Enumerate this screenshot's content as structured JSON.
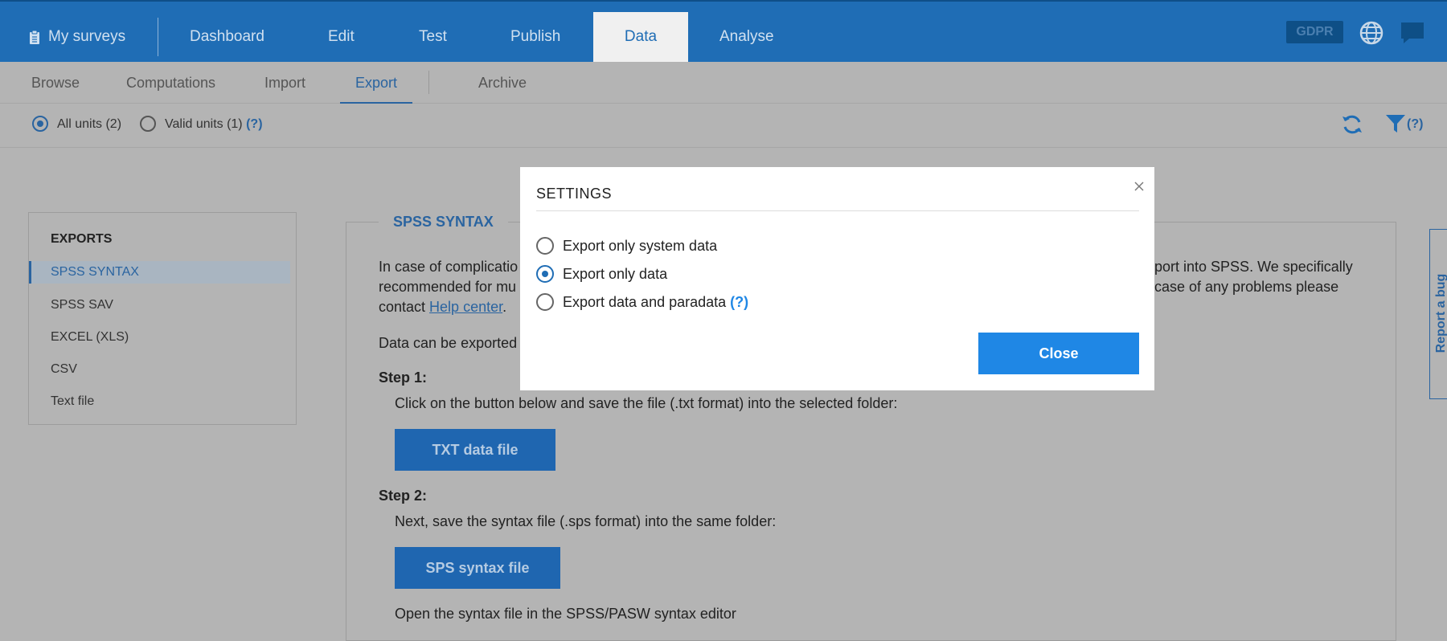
{
  "topnav": {
    "my_surveys": "My surveys",
    "items": [
      "Dashboard",
      "Edit",
      "Test",
      "Publish",
      "Data",
      "Analyse"
    ],
    "active": "Data",
    "gdpr": "GDPR"
  },
  "subnav": {
    "items": [
      "Browse",
      "Computations",
      "Import",
      "Export",
      "Archive"
    ],
    "active": "Export"
  },
  "filters": {
    "all_units": "All units (2)",
    "valid_units": "Valid units (1)",
    "help": "(?)",
    "selected": "All units (2)",
    "filter_help": "(?)"
  },
  "exports_panel": {
    "title": "EXPORTS",
    "items": [
      "SPSS SYNTAX",
      "SPSS SAV",
      "EXCEL (XLS)",
      "CSV",
      "Text file"
    ],
    "active": "SPSS SYNTAX"
  },
  "main": {
    "title": "SPSS SYNTAX",
    "intro_line1_left": "In case of complicatio",
    "intro_line1_right": "port into SPSS. We specifically",
    "intro_line2_left": "recommended for mu",
    "intro_line2_right": "case of any problems please",
    "intro_line3_prefix": "contact ",
    "help_center": "Help center",
    "intro_line3_suffix": ".",
    "data_line": "Data can be exported",
    "step1_title": "Step 1:",
    "step1_text": "Click on the button below and save the file (.txt format) into the selected folder:",
    "txt_button": "TXT data file",
    "step2_title": "Step 2:",
    "step2_text": "Next, save the syntax file (.sps format) into the same folder:",
    "sps_button": "SPS syntax file",
    "step3_text": "Open the syntax file in the SPSS/PASW syntax editor"
  },
  "report_bug": "Report a bug",
  "modal": {
    "title": "SETTINGS",
    "options": [
      "Export only system data",
      "Export only data",
      "Export data and paradata"
    ],
    "selected": "Export only data",
    "paradata_help": "(?)",
    "close_button": "Close"
  },
  "colors": {
    "brand_blue": "#1f6db5",
    "primary_button": "#1f87e5",
    "overlay_gray": "#b4b4b4"
  }
}
